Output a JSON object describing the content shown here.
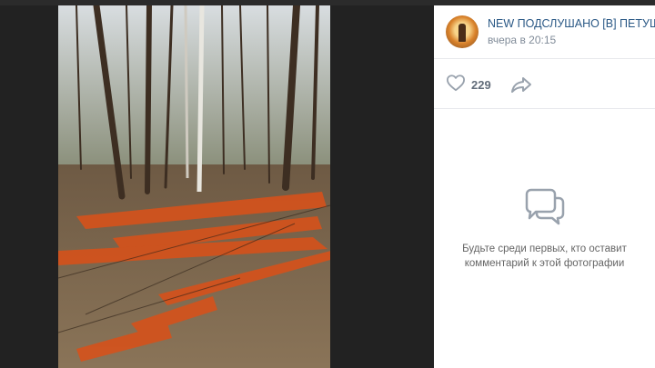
{
  "post": {
    "group_name": "NEW ПОДСЛУШАНО [В] ПЕТУШКАХ",
    "time": "вчера в 20:15",
    "likes": "229"
  },
  "comments": {
    "empty_line1": "Будьте среди первых, кто оставит",
    "empty_line2": "комментарий к этой фотографии"
  },
  "icons": {
    "like": "heart-outline-icon",
    "share": "share-arrow-icon",
    "comments": "comment-bubble-icon"
  },
  "colors": {
    "link": "#2a5885",
    "muted": "#818c99",
    "icon": "#99a2ad"
  }
}
